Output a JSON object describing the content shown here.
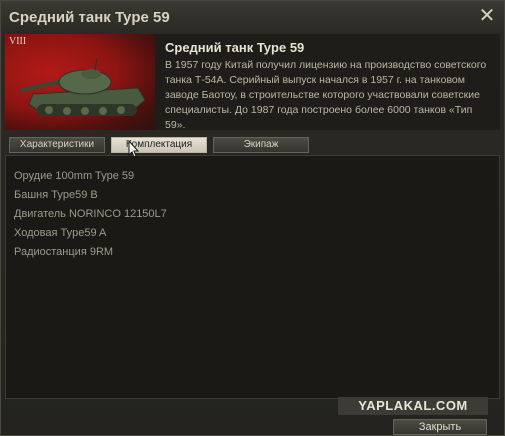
{
  "window": {
    "title": "Средний танк Type 59",
    "close_glyph": "✕"
  },
  "header": {
    "tier": "VIII",
    "tank_name": "Средний танк Type 59",
    "description": "В 1957 году Китай получил  лицензию на производство советского танка Т-54А. Серийный выпуск начался в 1957 г. на танковом заводе Баотоу, в строительстве которого участвовали советские специалисты. До 1987 года построено более 6000 танков «Тип 59»."
  },
  "tabs": [
    {
      "label": "Характеристики",
      "active": false
    },
    {
      "label": "Комплектация",
      "active": true
    },
    {
      "label": "Экипаж",
      "active": false
    }
  ],
  "modules": [
    "Орудие 100mm Type 59",
    "Башня Type59 B",
    "Двигатель NORINCO 12150L7",
    "Ходовая Type59 A",
    "Радиостанция 9RM"
  ],
  "watermark": "YAPLAKAL.COM",
  "footer": {
    "close_label": "Закрыть"
  },
  "colors": {
    "background": "#24231f",
    "flag_red": "#b21a17",
    "text": "#bdb7a5",
    "active_tab": "#e6e2d6"
  },
  "icons": [
    "close-icon",
    "china-flag-icon",
    "tank-icon",
    "mouse-cursor-icon"
  ]
}
